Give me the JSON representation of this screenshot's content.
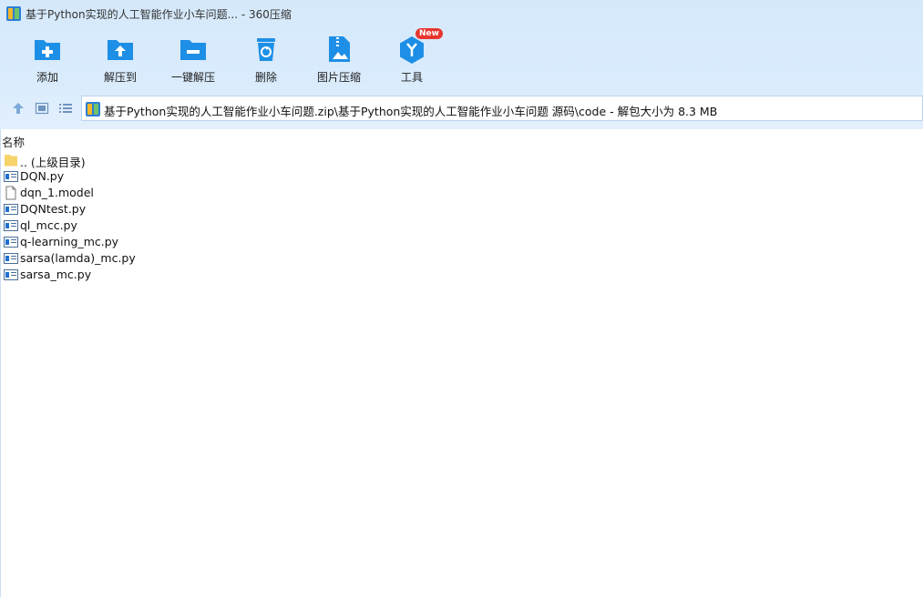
{
  "window": {
    "title": "基于Python实现的人工智能作业小车问题... - 360压缩"
  },
  "toolbar": {
    "items": [
      {
        "label": "添加"
      },
      {
        "label": "解压到"
      },
      {
        "label": "一键解压"
      },
      {
        "label": "删除"
      },
      {
        "label": "图片压缩"
      },
      {
        "label": "工具",
        "badge": "New"
      }
    ]
  },
  "address": {
    "path": "基于Python实现的人工智能作业小车问题.zip\\基于Python实现的人工智能作业小车问题 源码\\code - 解包大小为 8.3 MB"
  },
  "list": {
    "column_name": "名称",
    "files": [
      {
        "name": ".. (上级目录)",
        "type": "folder-up"
      },
      {
        "name": "DQN.py",
        "type": "py"
      },
      {
        "name": "dqn_1.model",
        "type": "file"
      },
      {
        "name": "DQNtest.py",
        "type": "py"
      },
      {
        "name": "ql_mcc.py",
        "type": "py"
      },
      {
        "name": "q-learning_mc.py",
        "type": "py"
      },
      {
        "name": "sarsa(lamda)_mc.py",
        "type": "py"
      },
      {
        "name": "sarsa_mc.py",
        "type": "py"
      }
    ]
  },
  "colors": {
    "accent": "#1e8fe6",
    "chrome_bg": "#d8eafc",
    "badge": "#e8362f"
  }
}
